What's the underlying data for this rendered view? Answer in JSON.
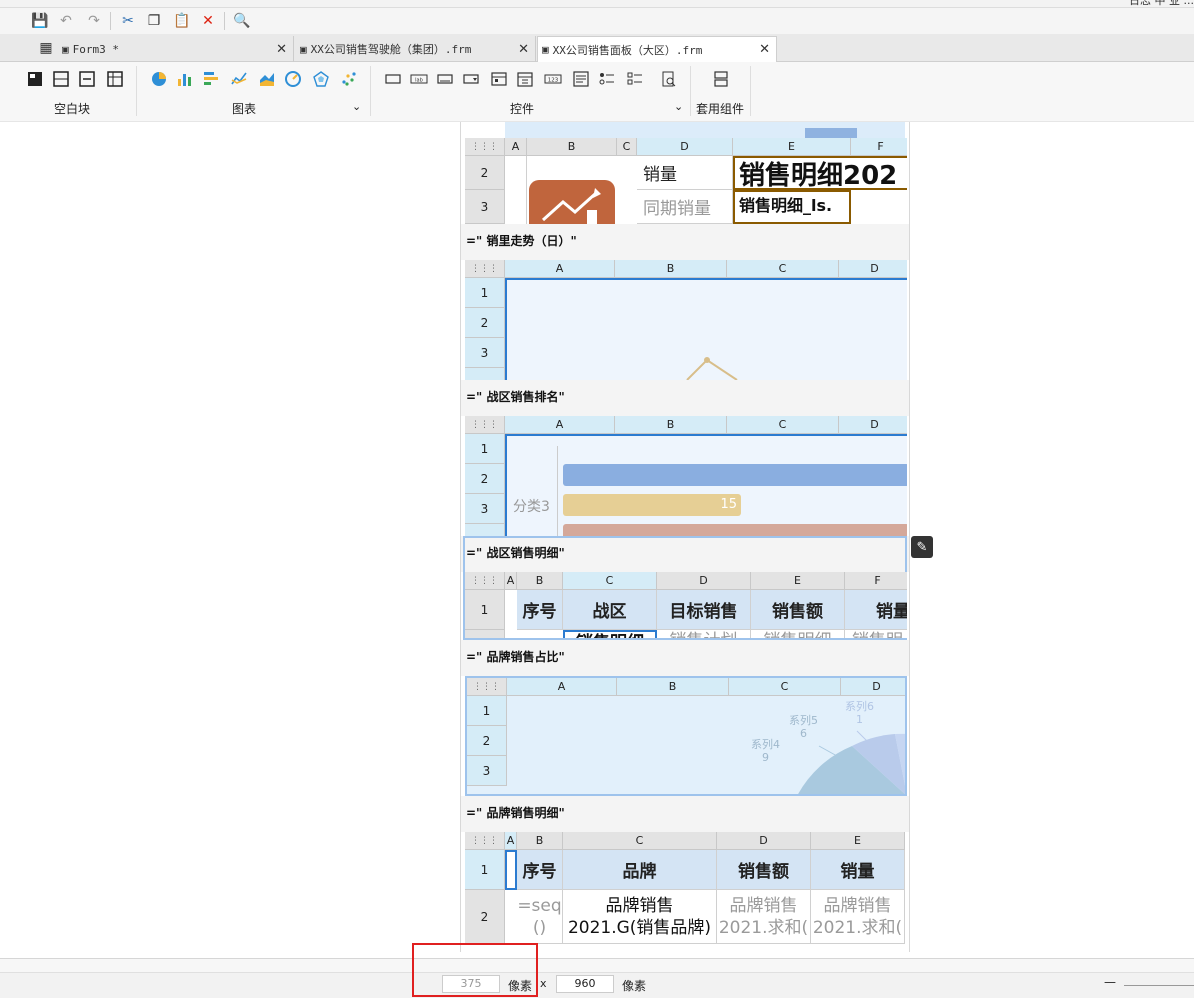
{
  "window": {
    "top_right_text": "日志  中  业  ..."
  },
  "tabs": [
    {
      "label": "Form3 *",
      "active": false
    },
    {
      "label": "XX公司销售驾驶舱（集团）.frm",
      "active": false
    },
    {
      "label": "XX公司销售面板（大区）.frm",
      "active": true
    }
  ],
  "ribbon": {
    "groups": [
      {
        "label": "空白块"
      },
      {
        "label": "图表"
      },
      {
        "label": "控件"
      },
      {
        "label": "套用组件"
      }
    ]
  },
  "widgets": {
    "top": {
      "cols": [
        "A",
        "B",
        "C",
        "D",
        "E",
        "F"
      ],
      "rows": [
        "2",
        "3"
      ],
      "sales_label": "销量",
      "same_period_label": "同期销量",
      "detail_title": "销售明细202",
      "detail_small": "销售明细_ls."
    },
    "trend": {
      "title": "=\" 销里走势（日）\"",
      "cols": [
        "A",
        "B",
        "C",
        "D"
      ],
      "rows": [
        "1",
        "2",
        "3"
      ]
    },
    "rank": {
      "title": "=\" 战区销售排名\"",
      "cols": [
        "A",
        "B",
        "C",
        "D"
      ],
      "rows": [
        "1",
        "2",
        "3"
      ],
      "category": "分类3",
      "bar_value": "15"
    },
    "region_detail": {
      "title": "=\" 战区销售明细\"",
      "cols": [
        "A",
        "B",
        "C",
        "D",
        "E",
        "F"
      ],
      "row": "1",
      "headers": [
        "序号",
        "战区",
        "目标销售",
        "销售额",
        "销量"
      ],
      "second_row": [
        "销售明细",
        "销售计划",
        "销售明细",
        "销售明"
      ]
    },
    "brand_share": {
      "title": "=\" 品牌销售占比\"",
      "cols": [
        "A",
        "B",
        "C",
        "D"
      ],
      "rows": [
        "1",
        "2",
        "3"
      ],
      "labels": [
        {
          "name": "系列4",
          "value": "9"
        },
        {
          "name": "系列5",
          "value": "6"
        },
        {
          "name": "系列6",
          "value": "1"
        }
      ]
    },
    "brand_detail": {
      "title": "=\" 品牌销售明细\"",
      "cols": [
        "A",
        "B",
        "C",
        "D",
        "E"
      ],
      "rows": [
        "1",
        "2"
      ],
      "headers": [
        "序号",
        "品牌",
        "销售额",
        "销量"
      ],
      "seq_formula": "=seq()",
      "brand_formula": "品牌销售2021.G(销售品牌)",
      "amount_formula": "品牌销售2021.求和(",
      "qty_formula": "品牌销售2021.求和("
    }
  },
  "bottom": {
    "width": "375",
    "unit": "像素",
    "times": "x",
    "height": "960",
    "unit2": "像素",
    "zoom_minus": "—"
  },
  "colors": {
    "accent": "#2b7bd0",
    "bar_blue": "#8aaee0",
    "bar_yellow": "#e6cf95",
    "bar_pink": "#d4a89a",
    "highlight_red": "#e02020"
  }
}
